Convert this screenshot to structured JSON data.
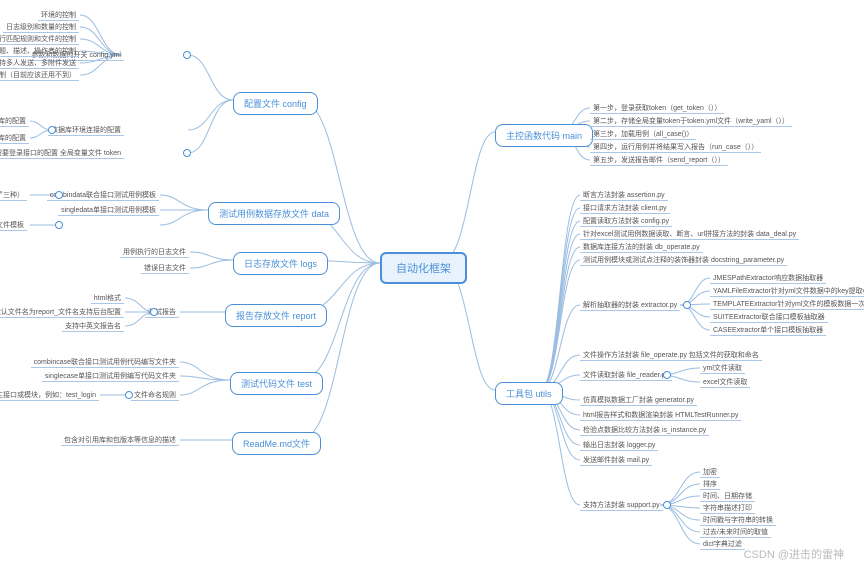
{
  "root": "自动化框架",
  "watermark": "CSDN @进击的雷神",
  "left": {
    "config": {
      "label": "配置文件 config",
      "items": [
        "参数和数据的开关 config.yml",
        "数据库环境连接的配置",
        "用于需要登录接口的配置    全局变量文件 token"
      ],
      "sub0": [
        "环境的控制",
        "日志级别和数量的控制",
        "用例执行匹配规则和文件的控制",
        "报告颗粒度、标题、描述、操作者的控制",
        "邮件发送的控制、支持多人发送、多附件发送",
        "socket接口的控制（目前应该还用不到）"
      ],
      "sub1": [
        "mysql数据库的配置",
        "redis数据库的配置"
      ]
    },
    "data": {
      "label": "测试用例数据存放文件 data",
      "items": [
        "combindata联合接口测试用例模板",
        "singledata单接口测试用例模板"
      ],
      "sub": [
        "yml文件模板（提供了三种）",
        "excel文件模板"
      ]
    },
    "logs": {
      "label": "日志存放文件 logs",
      "items": [
        "用例执行的日志文件",
        "错误日志文件"
      ]
    },
    "report": {
      "label": "报告存放文件 report",
      "items": [
        "测试报告"
      ],
      "sub": [
        "html格式",
        "默认文件名为report_文件名支持后台配置",
        "支持中英文报告名"
      ]
    },
    "test": {
      "label": "测试代码文件 test",
      "items": [
        "combincase联合接口测试用例代码编写文件夹",
        "singlecase单接口测试用例编写代码文件夹",
        "文件命名规则"
      ],
      "sub": [
        "文件命名以test_开头后加主接口或模块，例如：test_login"
      ]
    },
    "readme": {
      "label": "ReadMe.md文件",
      "items": [
        "包含对引用库和包版本等信息的描述"
      ]
    }
  },
  "right": {
    "main": {
      "label": "主控函数代码 main",
      "items": [
        "第一步，登录获取token（get_token（））",
        "第二步，存储全局变量token于token.yml文件（write_yaml（））",
        "第三步，加载用例（all_case()）",
        "第四步，运行用例并将结果写入报告（run_case（））",
        "第五步，发送报告邮件（send_report（））"
      ]
    },
    "utils": {
      "label": "工具包 utils",
      "items": [
        "断言方法封装 assertion.py",
        "接口请求方法封装 client.py",
        "配置读取方法封装 config.py",
        "针对excel测试用例数据读取、断言、url拼接方法的封装 data_deal.py",
        "数据库连接方法的封装 db_operate.py",
        "测试用例模块或测试点注释的装饰器封装 docstring_parameter.py",
        "解析抽取器的封装 extractor.py",
        "文件操作方法封装 file_operate.py 包括文件的获取和命名",
        "文件读取封装 file_reader.py",
        "仿真模拟数据工厂封装 generator.py",
        "html报告样式和数据渲染封装 HTMLTestRunner.py",
        "检验点数据比较方法封装 is_instance.py",
        "输出日志封装 logger.py",
        "发送邮件封装 mail.py",
        "支持方法封装 support.py"
      ],
      "extractor": [
        "JMESPathExtractor响应数据抽取器",
        "YAMLFileExtractor针对yml文件数据中的key提取value的抽取器",
        "TEMPLATEExtractor针对yml文件的模板数据一次性抽取器",
        "SUITEExtractor联合接口模板抽取器",
        "CASEExtractor单个接口模板抽取器"
      ],
      "file_reader": [
        "yml文件读取",
        "excel文件读取"
      ],
      "support": [
        "加密",
        "排序",
        "时间、日期存储",
        "字符串描述打印",
        "时间戳与字符串的转换",
        "过去/未来时间的取值",
        "dict字典过滤"
      ]
    }
  }
}
